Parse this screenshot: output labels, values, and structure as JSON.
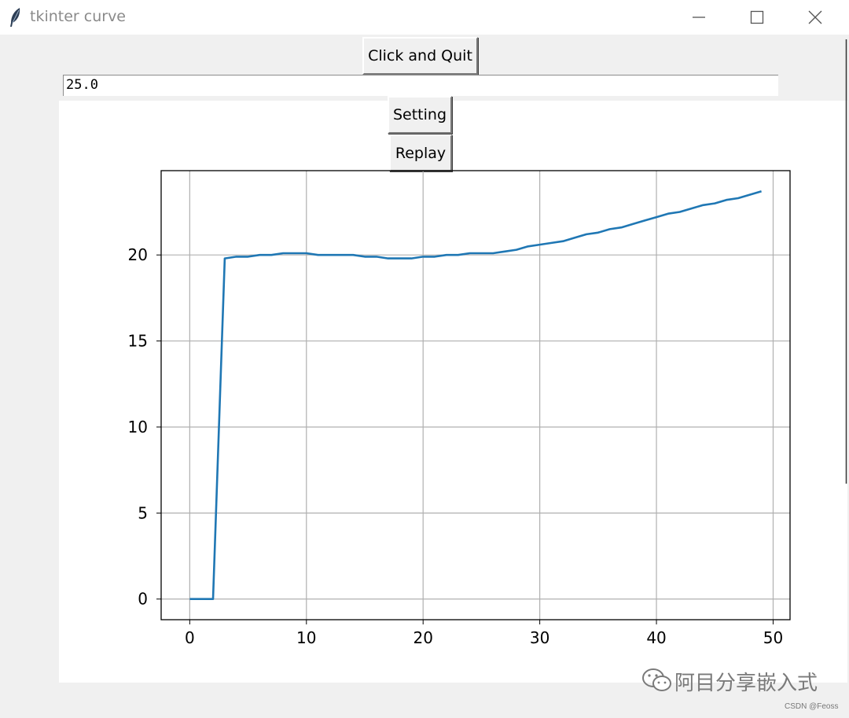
{
  "window": {
    "title": "tkinter curve",
    "controls": [
      "minimize-icon",
      "maximize-icon",
      "close-icon"
    ]
  },
  "buttons": {
    "quit_label": "Click and Quit",
    "setting_label": "Setting",
    "replay_label": "Replay"
  },
  "entry": {
    "value": "25.0"
  },
  "watermark": {
    "text": "阿目分享嵌入式",
    "credit": "CSDN @Feoss",
    "icon": "wechat-icon"
  },
  "chart_data": {
    "type": "line",
    "title": "",
    "xlabel": "",
    "ylabel": "",
    "xlim": [
      -2.45,
      51.45
    ],
    "ylim": [
      -1.2,
      24.9
    ],
    "grid": true,
    "xticks": [
      0,
      10,
      20,
      30,
      40,
      50
    ],
    "yticks": [
      0,
      5,
      10,
      15,
      20
    ],
    "series": [
      {
        "color": "#1f77b4",
        "x": [
          0,
          1,
          2,
          3,
          4,
          5,
          6,
          7,
          8,
          9,
          10,
          11,
          12,
          13,
          14,
          15,
          16,
          17,
          18,
          19,
          20,
          21,
          22,
          23,
          24,
          25,
          26,
          27,
          28,
          29,
          30,
          31,
          32,
          33,
          34,
          35,
          36,
          37,
          38,
          39,
          40,
          41,
          42,
          43,
          44,
          45,
          46,
          47,
          48,
          49
        ],
        "y": [
          0,
          0,
          0,
          19.8,
          19.9,
          19.9,
          20,
          20,
          20.1,
          20.1,
          20.1,
          20,
          20,
          20,
          20,
          19.9,
          19.9,
          19.8,
          19.8,
          19.8,
          19.9,
          19.9,
          20,
          20,
          20.1,
          20.1,
          20.1,
          20.2,
          20.3,
          20.5,
          20.6,
          20.7,
          20.8,
          21,
          21.2,
          21.3,
          21.5,
          21.6,
          21.8,
          22,
          22.2,
          22.4,
          22.5,
          22.7,
          22.9,
          23,
          23.2,
          23.3,
          23.5,
          23.7
        ]
      }
    ]
  }
}
